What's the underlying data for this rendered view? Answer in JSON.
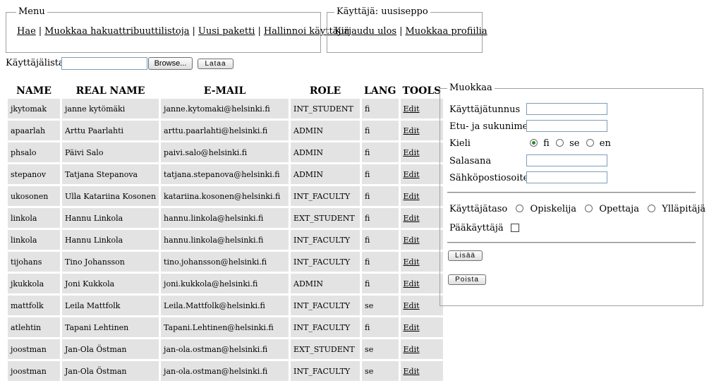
{
  "menu": {
    "legend": "Menu",
    "links": [
      "Hae",
      "Muokkaa hakuattribuuttilistoja",
      "Uusi paketti",
      "Hallinnoi käyttäjiä"
    ]
  },
  "user_box": {
    "legend": "Käyttäjä: uusiseppo",
    "links": [
      "Kirjaudu ulos",
      "Muokkaa profiilia"
    ]
  },
  "upload": {
    "label": "Käyttäjälista",
    "file_value": "",
    "browse_label": "Browse...",
    "load_label": "Lataa"
  },
  "table": {
    "columns": [
      "NAME",
      "REAL NAME",
      "E-MAIL",
      "ROLE",
      "LANG",
      "TOOLS"
    ],
    "edit_label": "Edit",
    "rows": [
      [
        "jkytomak",
        "janne kytömäki",
        "janne.kytomaki@helsinki.fi",
        "INT_STUDENT",
        "fi"
      ],
      [
        "apaarlah",
        "Arttu Paarlahti",
        "arttu.paarlahti@helsinki.fi",
        "ADMIN",
        "fi"
      ],
      [
        "phsalo",
        "Päivi Salo",
        "paivi.salo@helsinki.fi",
        "ADMIN",
        "fi"
      ],
      [
        "stepanov",
        "Tatjana Stepanova",
        "tatjana.stepanova@helsinki.fi",
        "ADMIN",
        "fi"
      ],
      [
        "ukosonen",
        "Ulla Katariina Kosonen",
        "katariina.kosonen@helsinki.fi",
        "INT_FACULTY",
        "fi"
      ],
      [
        "linkola",
        "Hannu Linkola",
        "hannu.linkola@helsinki.fi",
        "EXT_STUDENT",
        "fi"
      ],
      [
        "linkola",
        "Hannu Linkola",
        "hannu.linkola@helsinki.fi",
        "INT_FACULTY",
        "fi"
      ],
      [
        "tijohans",
        "Tino Johansson",
        "tino.johansson@helsinki.fi",
        "INT_FACULTY",
        "fi"
      ],
      [
        "jkukkola",
        "Joni Kukkola",
        "joni.kukkola@helsinki.fi",
        "ADMIN",
        "fi"
      ],
      [
        "mattfolk",
        "Leila Mattfolk",
        "Leila.Mattfolk@helsinki.fi",
        "INT_FACULTY",
        "se"
      ],
      [
        "atlehtin",
        "Tapani Lehtinen",
        "Tapani.Lehtinen@helsinki.fi",
        "INT_FACULTY",
        "fi"
      ],
      [
        "joostman",
        "Jan-Ola Östman",
        "jan-ola.ostman@helsinki.fi",
        "EXT_STUDENT",
        "se"
      ],
      [
        "joostman",
        "Jan-Ola Östman",
        "jan-ola.ostman@helsinki.fi",
        "INT_FACULTY",
        "se"
      ]
    ]
  },
  "edit_form": {
    "legend": "Muokkaa",
    "username_label": "Käyttäjätunnus",
    "username_value": "",
    "fullname_label": "Etu- ja sukunimet",
    "fullname_value": "",
    "language_label": "Kieli",
    "language_options": [
      "fi",
      "se",
      "en"
    ],
    "language_selected": "fi",
    "password_label": "Salasana",
    "password_value": "",
    "email_label": "Sähköpostiosoite",
    "email_value": "",
    "level_label": "Käyttäjätaso",
    "level_options": [
      "Opiskelija",
      "Opettaja",
      "Ylläpitäjä"
    ],
    "superuser_label": "Pääkäyttäjä",
    "add_label": "Lisää",
    "delete_label": "Poista"
  },
  "colors": {
    "cell_bg": "#e3e3e3",
    "border": "#a0a0a0",
    "radio_selected": "#2b8a2b"
  },
  "icons": {
    "radio": "radio-button",
    "checkbox": "checkbox"
  }
}
